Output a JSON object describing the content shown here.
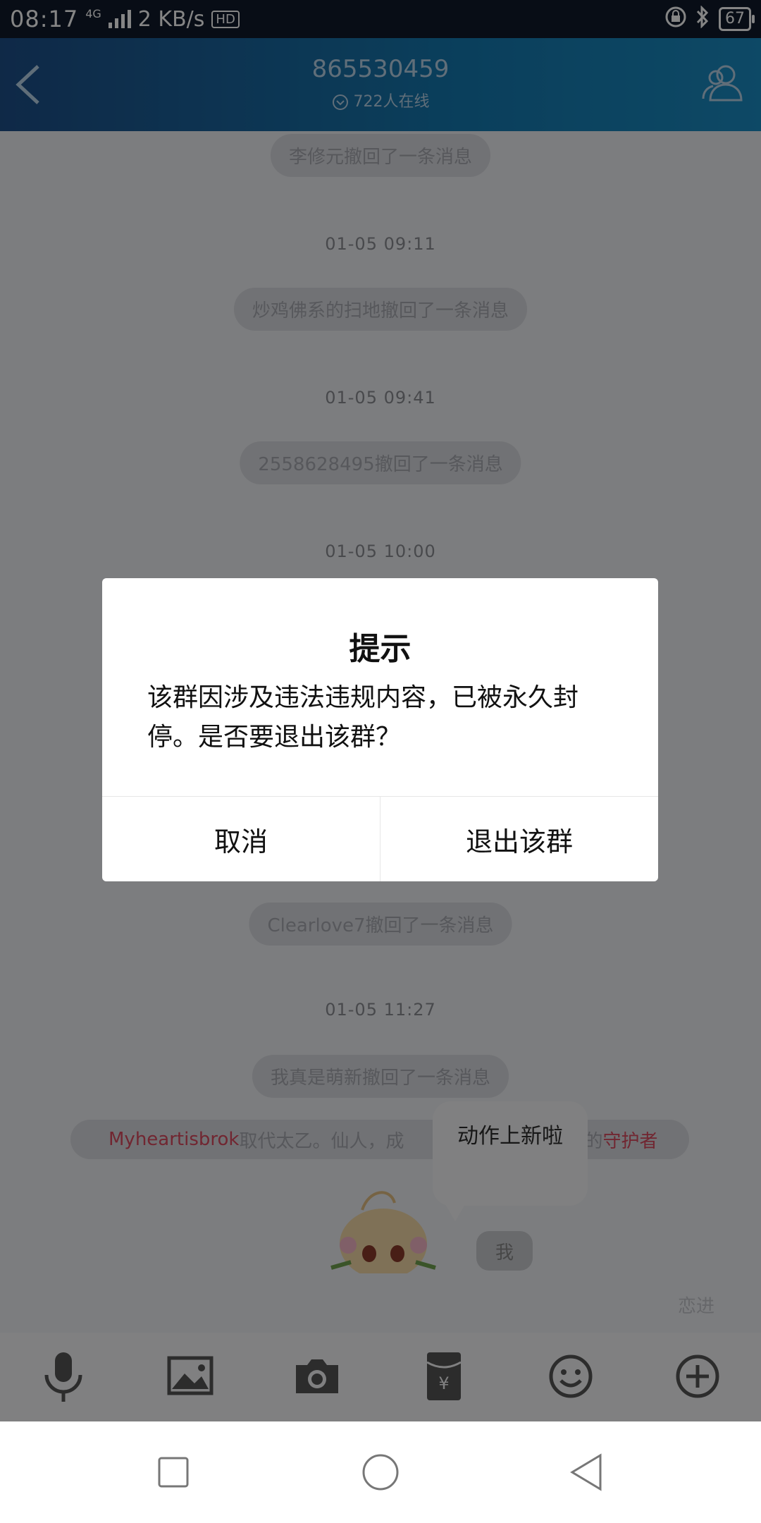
{
  "status_bar": {
    "time": "08:17",
    "network": "4G",
    "speed": "2 KB/s",
    "hd": "HD",
    "battery": "67"
  },
  "header": {
    "title": "865530459",
    "online": "722人在线"
  },
  "chat": {
    "recall_1": "李修元撤回了一条消息",
    "time_1": "01-05 09:11",
    "recall_2": "炒鸡佛系的扫地撤回了一条消息",
    "time_2": "01-05 09:41",
    "recall_3": "2558628495撤回了一条消息",
    "time_3": "01-05 10:00",
    "recall_4": "Clearlove7撤回了一条消息",
    "time_4": "01-05 11:27",
    "recall_5": "我真是萌新撤回了一条消息",
    "guardian": {
      "name": "Myheartisbrok",
      "middle": "取代太乙。仙人，成",
      "suffix": "的",
      "title": "守护者"
    },
    "bubble_text": "动作上新啦",
    "me_tag": "我",
    "hint": "恋进"
  },
  "dialog": {
    "title": "提示",
    "message": "该群因涉及违法违规内容，已被永久封停。是否要退出该群？",
    "cancel": "取消",
    "exit": "退出该群"
  },
  "colors": {
    "header_start": "#1d4f89",
    "header_end": "#1a8cc3",
    "highlight": "#d84a5e"
  },
  "icons": [
    "back-icon",
    "profile-icon",
    "microphone-icon",
    "image-icon",
    "camera-icon",
    "red-packet-icon",
    "emoji-icon",
    "plus-icon",
    "recent-apps-icon",
    "home-icon",
    "back-nav-icon"
  ]
}
